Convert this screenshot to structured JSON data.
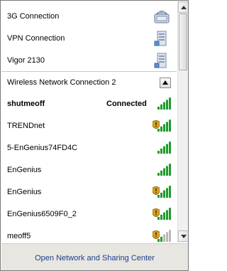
{
  "connections": [
    {
      "label": "3G Connection",
      "icon": "phone-modem-icon"
    },
    {
      "label": "VPN Connection",
      "icon": "network-computer-icon"
    },
    {
      "label": "Vigor 2130",
      "icon": "network-computer-icon"
    }
  ],
  "wireless_section": {
    "title": "Wireless Network Connection 2",
    "collapse_icon": "collapse-up-icon"
  },
  "networks": [
    {
      "name": "shutmeoff",
      "status": "Connected",
      "secured": false,
      "signal": 5,
      "bold": true
    },
    {
      "name": "TRENDnet",
      "status": "",
      "secured": true,
      "signal": 5,
      "bold": false
    },
    {
      "name": "5-EnGenius74FD4C",
      "status": "",
      "secured": false,
      "signal": 5,
      "bold": false
    },
    {
      "name": "EnGenius",
      "status": "",
      "secured": false,
      "signal": 5,
      "bold": false
    },
    {
      "name": "EnGenius",
      "status": "",
      "secured": true,
      "signal": 5,
      "bold": false
    },
    {
      "name": "EnGenius6509F0_2",
      "status": "",
      "secured": true,
      "signal": 5,
      "bold": false
    },
    {
      "name": "meoff5",
      "status": "",
      "secured": true,
      "signal": 2,
      "bold": false
    }
  ],
  "footer": {
    "link": "Open Network and Sharing Center"
  },
  "colors": {
    "signal_active": "#1e9b2b",
    "signal_inactive": "#b8b8b8",
    "shield_gold": "#d9a21b",
    "link": "#1a3f8f",
    "footer_bg": "#e8e6e1"
  }
}
